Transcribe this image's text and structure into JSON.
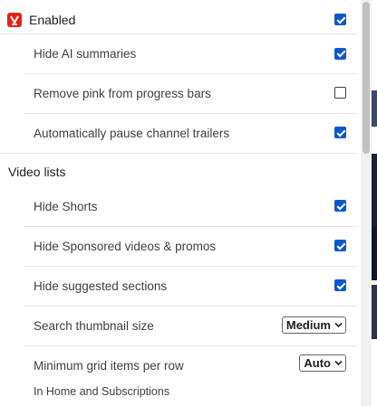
{
  "header": {
    "label": "Enabled",
    "checked": true
  },
  "general_items": [
    {
      "label": "Hide AI summaries",
      "checked": true
    },
    {
      "label": "Remove pink from progress bars",
      "checked": false
    },
    {
      "label": "Automatically pause channel trailers",
      "checked": true
    }
  ],
  "video_lists": {
    "title": "Video lists",
    "items": [
      {
        "label": "Hide Shorts",
        "checked": true
      },
      {
        "label": "Hide Sponsored videos & promos",
        "checked": true
      },
      {
        "label": "Hide suggested sections",
        "checked": true
      }
    ],
    "thumbnail_size": {
      "label": "Search thumbnail size",
      "value": "Medium"
    },
    "grid_items": {
      "label": "Minimum grid items per row",
      "value": "Auto",
      "note": "In Home and Subscriptions"
    }
  },
  "colors": {
    "accent": "#0b57d0",
    "icon": "#e0241b"
  },
  "icons": {
    "app": "app-logo-icon",
    "dropdown": "chevron-down-icon"
  }
}
